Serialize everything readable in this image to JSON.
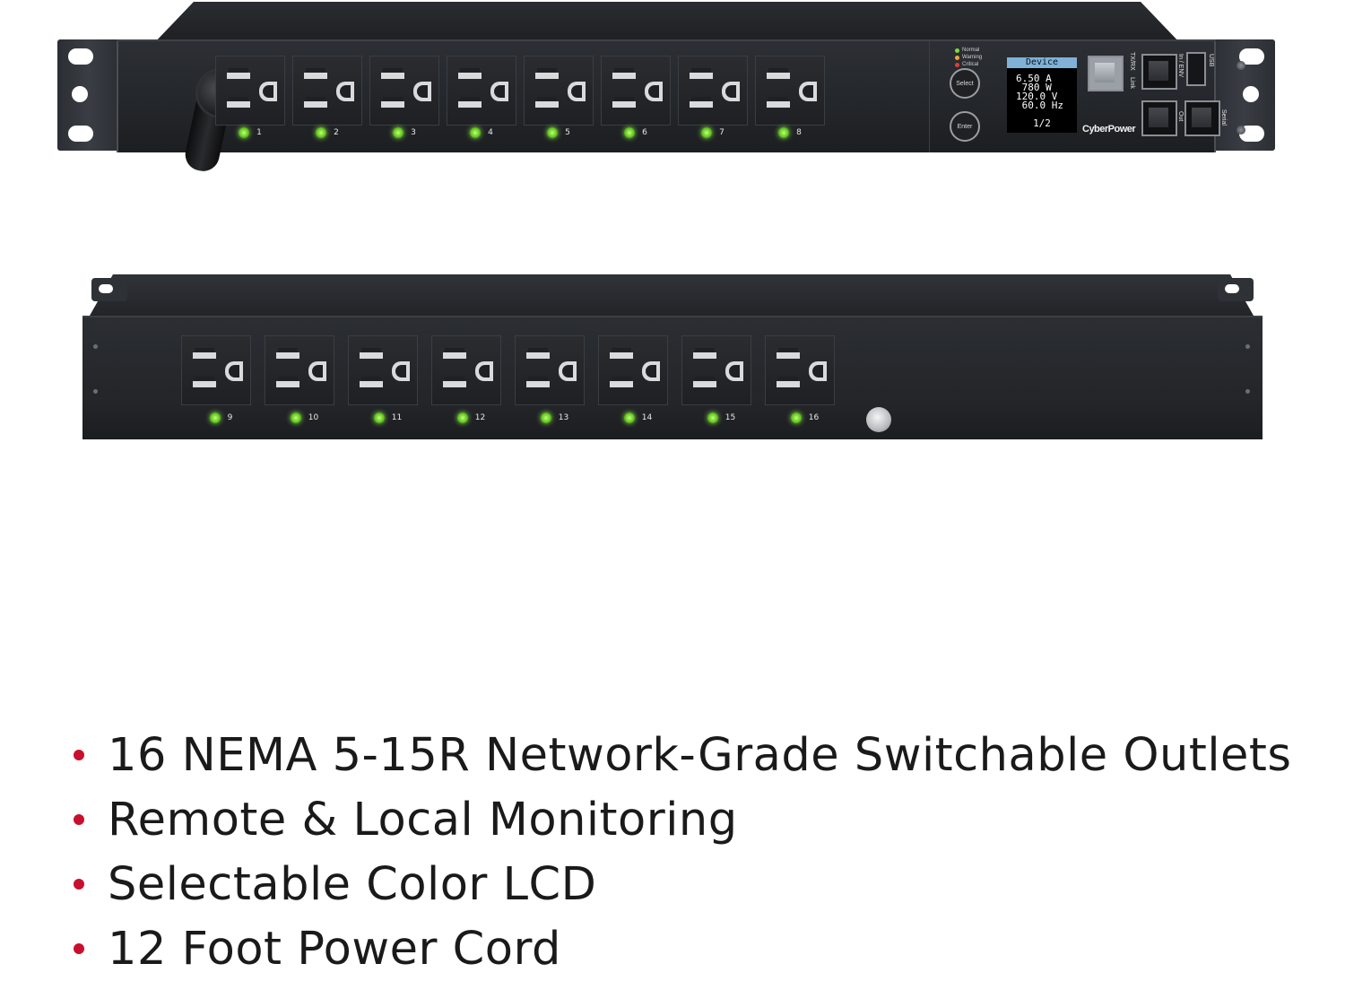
{
  "front_panel": {
    "outlets": [
      "1",
      "2",
      "3",
      "4",
      "5",
      "6",
      "7",
      "8"
    ],
    "status_labels": [
      "Normal",
      "Warning",
      "Critical"
    ],
    "status_colors": [
      "#7bdc3a",
      "#f2a33a",
      "#e23b3b"
    ],
    "select_label": "Select",
    "enter_label": "Enter",
    "lcd": {
      "header": "Device",
      "line1": "6.50 A",
      "line2": " 780 W",
      "line3": "120.0 V",
      "line4": " 60.0 Hz",
      "page": "1/2"
    },
    "brand": "CyberPower",
    "port_labels": {
      "txrx": "TX/RX",
      "link": "Link",
      "in_env": "In / ENV",
      "usb": "USB",
      "out": "Out",
      "serial": "Serial"
    }
  },
  "rear_panel": {
    "outlets": [
      "9",
      "10",
      "11",
      "12",
      "13",
      "14",
      "15",
      "16"
    ]
  },
  "features": {
    "bullet_color": "#c8102e",
    "items": [
      "16 NEMA 5-15R Network-Grade Switchable Outlets",
      "Remote & Local Monitoring",
      "Selectable Color LCD",
      "12 Foot Power Cord"
    ]
  }
}
